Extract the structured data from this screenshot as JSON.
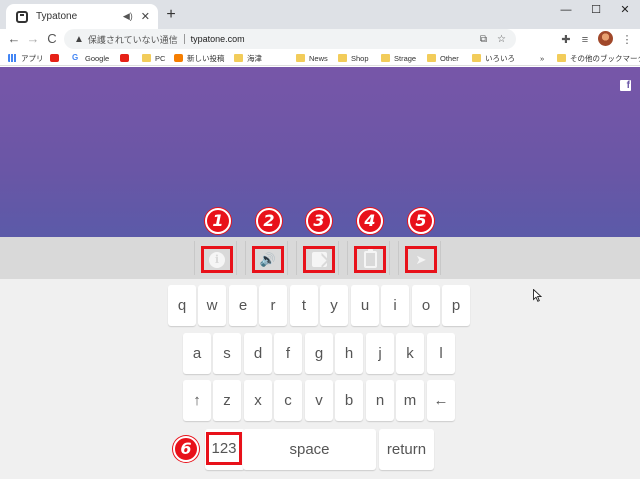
{
  "browser": {
    "tab_title": "Typatone",
    "tab_audio_glyph": "◀)",
    "tab_close_glyph": "✕",
    "newtab_glyph": "+",
    "minimize_glyph": "—",
    "maximize_glyph": "☐",
    "close_glyph": "✕",
    "back_glyph": "←",
    "forward_glyph": "→",
    "reload_glyph": "C",
    "security_text": "保護されていない通信",
    "url": "typatone.com",
    "bookmarks": [
      {
        "label": "アプリ",
        "icon": "apps-icon"
      },
      {
        "label": "Google",
        "icon": "google-icon"
      },
      {
        "label": "",
        "icon": "youtube-icon"
      },
      {
        "label": "PC",
        "icon": "folder-icon"
      },
      {
        "label": "新しい投稿",
        "icon": "blogger-icon"
      },
      {
        "label": "海津",
        "icon": "folder-icon"
      },
      {
        "label": "News",
        "icon": "folder-icon"
      },
      {
        "label": "Shop",
        "icon": "folder-icon"
      },
      {
        "label": "Strage",
        "icon": "folder-icon"
      },
      {
        "label": "Other",
        "icon": "folder-icon"
      },
      {
        "label": "いろいろ",
        "icon": "folder-icon"
      }
    ],
    "bookmarks_more": "»",
    "other_bookmarks": "その他のブックマーク"
  },
  "page": {
    "facebook_glyph": "f",
    "tools": [
      {
        "name": "info-icon",
        "badge": "1"
      },
      {
        "name": "speaker-icon",
        "badge": "2"
      },
      {
        "name": "image-icon",
        "badge": "3"
      },
      {
        "name": "clipboard-icon",
        "badge": "4"
      },
      {
        "name": "send-icon",
        "badge": "5"
      }
    ],
    "tool_glyphs": {
      "info": "i",
      "speaker": "🔊",
      "send": "➤"
    },
    "keyboard": {
      "row1": [
        "q",
        "w",
        "e",
        "r",
        "t",
        "y",
        "u",
        "i",
        "o",
        "p"
      ],
      "row2": [
        "a",
        "s",
        "d",
        "f",
        "g",
        "h",
        "j",
        "k",
        "l"
      ],
      "shift": "↑",
      "row3": [
        "z",
        "x",
        "c",
        "v",
        "b",
        "n",
        "m"
      ],
      "backspace": "←",
      "numbers": "123",
      "space": "space",
      "return": "return",
      "numbers_badge": "6"
    }
  },
  "colors": {
    "hero_top": "#7756a8",
    "hero_bottom": "#5b5aa8",
    "highlight": "#e8111a",
    "toolbar_bg": "#d9d9d9",
    "keyboard_bg": "#f0f0f0"
  }
}
